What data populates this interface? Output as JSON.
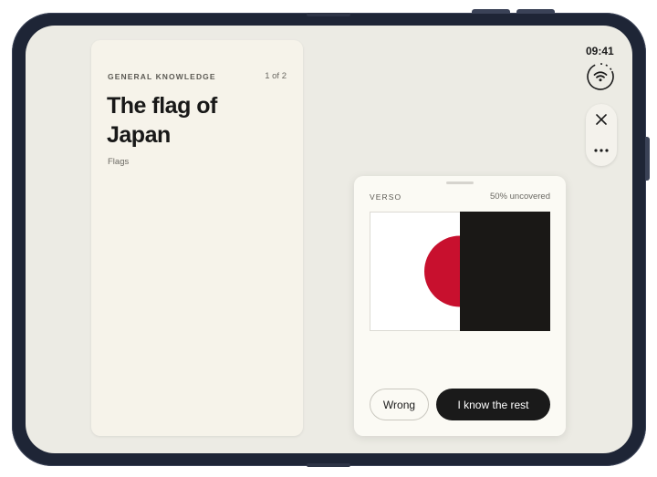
{
  "status": {
    "time": "09:41"
  },
  "card": {
    "category": "GENERAL KNOWLEDGE",
    "counter": "1 of 2",
    "title": "The flag of Japan",
    "subtitle": "Flags"
  },
  "verso": {
    "label": "VERSO",
    "uncovered": "50% uncovered",
    "uncovered_fraction": 0.5,
    "flag_colors": {
      "field": "#ffffff",
      "disc": "#c8102e",
      "cover": "#1a1816"
    }
  },
  "actions": {
    "wrong_label": "Wrong",
    "know_label": "I know the rest"
  },
  "icons": {
    "wifi": "wifi-icon",
    "close": "close-icon",
    "more": "more-icon"
  }
}
